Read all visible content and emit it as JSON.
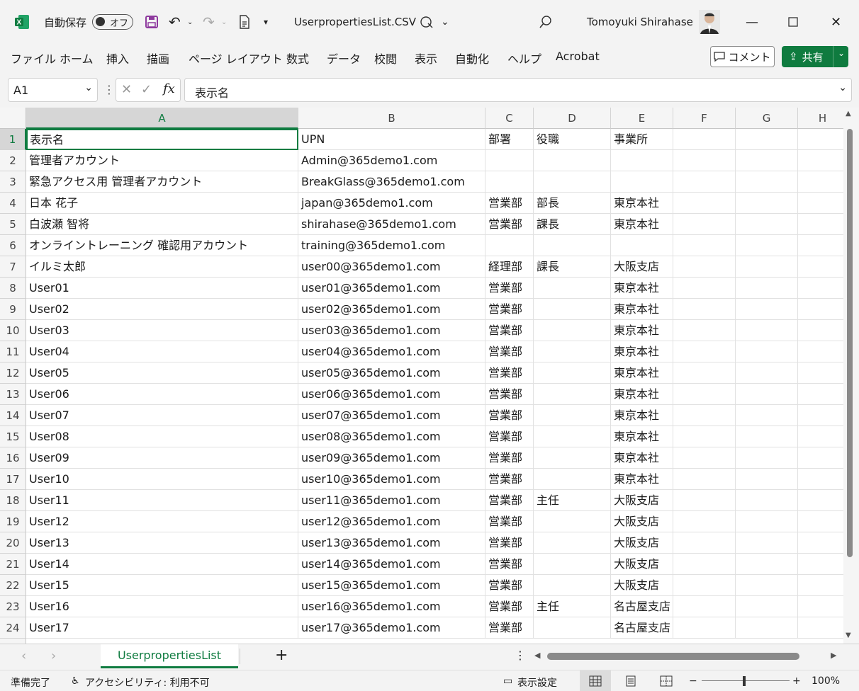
{
  "title_bar": {
    "autosave_label": "自動保存",
    "autosave_state": "オフ",
    "file_name": "UserpropertiesList.CSV",
    "user_name": "Tomoyuki Shirahase"
  },
  "menu": {
    "items": [
      "ファイル",
      "ホーム",
      "挿入",
      "描画",
      "ページ レイアウト",
      "数式",
      "データ",
      "校閲",
      "表示",
      "自動化",
      "ヘルプ",
      "Acrobat"
    ],
    "comment_label": "コメント",
    "share_label": "共有"
  },
  "formula_bar": {
    "name_box": "A1",
    "fx_symbol": "fx",
    "formula": "表示名"
  },
  "sheet": {
    "columns": [
      "A",
      "B",
      "C",
      "D",
      "E",
      "F",
      "G",
      "H"
    ],
    "rows": [
      {
        "n": "1",
        "cells": [
          "表示名",
          "UPN",
          "部署",
          "役職",
          "事業所"
        ]
      },
      {
        "n": "2",
        "cells": [
          "管理者アカウント",
          "Admin@365demo1.com",
          "",
          "",
          ""
        ]
      },
      {
        "n": "3",
        "cells": [
          "緊急アクセス用 管理者アカウント",
          "BreakGlass@365demo1.com",
          "",
          "",
          ""
        ]
      },
      {
        "n": "4",
        "cells": [
          "日本 花子",
          "japan@365demo1.com",
          "営業部",
          "部長",
          "東京本社"
        ]
      },
      {
        "n": "5",
        "cells": [
          "白波瀬 智将",
          "shirahase@365demo1.com",
          "営業部",
          "課長",
          "東京本社"
        ]
      },
      {
        "n": "6",
        "cells": [
          "オンライントレーニング 確認用アカウント",
          "training@365demo1.com",
          "",
          "",
          ""
        ]
      },
      {
        "n": "7",
        "cells": [
          "イルミ太郎",
          "user00@365demo1.com",
          "経理部",
          "課長",
          "大阪支店"
        ]
      },
      {
        "n": "8",
        "cells": [
          "User01",
          "user01@365demo1.com",
          "営業部",
          "",
          "東京本社"
        ]
      },
      {
        "n": "9",
        "cells": [
          "User02",
          "user02@365demo1.com",
          "営業部",
          "",
          "東京本社"
        ]
      },
      {
        "n": "10",
        "cells": [
          "User03",
          "user03@365demo1.com",
          "営業部",
          "",
          "東京本社"
        ]
      },
      {
        "n": "11",
        "cells": [
          "User04",
          "user04@365demo1.com",
          "営業部",
          "",
          "東京本社"
        ]
      },
      {
        "n": "12",
        "cells": [
          "User05",
          "user05@365demo1.com",
          "営業部",
          "",
          "東京本社"
        ]
      },
      {
        "n": "13",
        "cells": [
          "User06",
          "user06@365demo1.com",
          "営業部",
          "",
          "東京本社"
        ]
      },
      {
        "n": "14",
        "cells": [
          "User07",
          "user07@365demo1.com",
          "営業部",
          "",
          "東京本社"
        ]
      },
      {
        "n": "15",
        "cells": [
          "User08",
          "user08@365demo1.com",
          "営業部",
          "",
          "東京本社"
        ]
      },
      {
        "n": "16",
        "cells": [
          "User09",
          "user09@365demo1.com",
          "営業部",
          "",
          "東京本社"
        ]
      },
      {
        "n": "17",
        "cells": [
          "User10",
          "user10@365demo1.com",
          "営業部",
          "",
          "東京本社"
        ]
      },
      {
        "n": "18",
        "cells": [
          "User11",
          "user11@365demo1.com",
          "営業部",
          "主任",
          "大阪支店"
        ]
      },
      {
        "n": "19",
        "cells": [
          "User12",
          "user12@365demo1.com",
          "営業部",
          "",
          "大阪支店"
        ]
      },
      {
        "n": "20",
        "cells": [
          "User13",
          "user13@365demo1.com",
          "営業部",
          "",
          "大阪支店"
        ]
      },
      {
        "n": "21",
        "cells": [
          "User14",
          "user14@365demo1.com",
          "営業部",
          "",
          "大阪支店"
        ]
      },
      {
        "n": "22",
        "cells": [
          "User15",
          "user15@365demo1.com",
          "営業部",
          "",
          "大阪支店"
        ]
      },
      {
        "n": "23",
        "cells": [
          "User16",
          "user16@365demo1.com",
          "営業部",
          "主任",
          "名古屋支店"
        ]
      },
      {
        "n": "24",
        "cells": [
          "User17",
          "user17@365demo1.com",
          "営業部",
          "",
          "名古屋支店"
        ]
      }
    ]
  },
  "tabs": {
    "active_sheet": "UserpropertiesList",
    "add_symbol": "+"
  },
  "status": {
    "ready": "準備完了",
    "accessibility": "アクセシビリティ: 利用不可",
    "display_settings": "表示設定",
    "zoom": "100%"
  },
  "colors": {
    "excel_green": "#107c41",
    "share_green": "#0f7b3f"
  }
}
